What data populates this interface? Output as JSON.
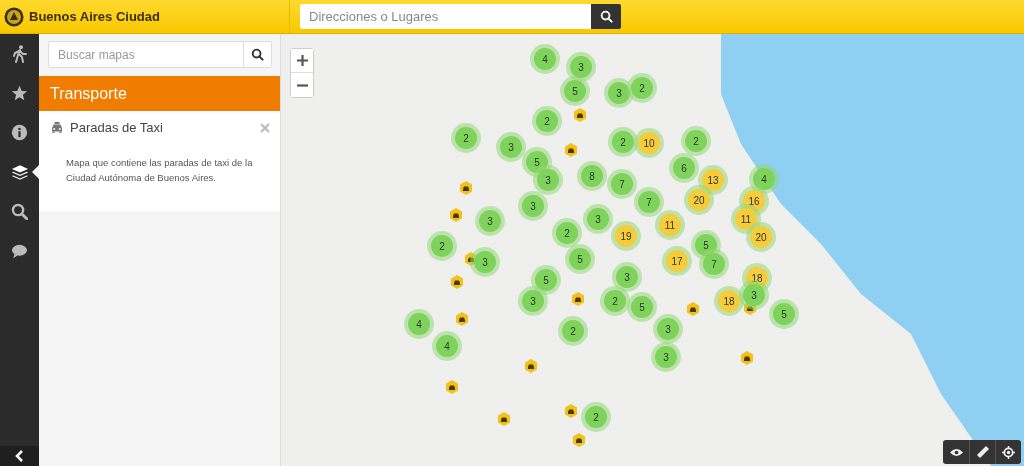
{
  "header": {
    "brand": "Buenos Aires Ciudad",
    "search": {
      "placeholder": "Direcciones o Lugares"
    }
  },
  "rail": [
    {
      "kind": "walk",
      "selected": false
    },
    {
      "kind": "star",
      "selected": false
    },
    {
      "kind": "info",
      "selected": false
    },
    {
      "kind": "layers",
      "selected": true
    },
    {
      "kind": "search",
      "selected": false
    },
    {
      "kind": "chat",
      "selected": false
    }
  ],
  "panel": {
    "search": {
      "placeholder": "Buscar mapas"
    },
    "title": "Transporte",
    "layers": [
      {
        "name": "Paradas de Taxi",
        "description": "Mapa que contiene las paradas de taxi de la Ciudad Autónoma de Buenos Aires."
      }
    ]
  },
  "map": {
    "clusters": [
      {
        "count": "4",
        "color": "#7ed35a"
      },
      {
        "count": "5",
        "color": "#7ed35a"
      },
      {
        "count": "3",
        "color": "#7ed35a"
      },
      {
        "count": "3",
        "color": "#7ed35a"
      },
      {
        "count": "2",
        "color": "#7ed35a"
      },
      {
        "count": "2",
        "color": "#7ed35a"
      },
      {
        "count": "3",
        "color": "#7ed35a"
      },
      {
        "count": "2",
        "color": "#7ed35a"
      },
      {
        "count": "2",
        "color": "#7ed35a"
      },
      {
        "count": "10",
        "color": "#f4cc3c"
      },
      {
        "count": "2",
        "color": "#7ed35a"
      },
      {
        "count": "5",
        "color": "#7ed35a"
      },
      {
        "count": "3",
        "color": "#7ed35a"
      },
      {
        "count": "8",
        "color": "#7ed35a"
      },
      {
        "count": "7",
        "color": "#7ed35a"
      },
      {
        "count": "6",
        "color": "#7ed35a"
      },
      {
        "count": "13",
        "color": "#f4cc3c"
      },
      {
        "count": "4",
        "color": "#7ed35a"
      },
      {
        "count": "3",
        "color": "#7ed35a"
      },
      {
        "count": "7",
        "color": "#7ed35a"
      },
      {
        "count": "20",
        "color": "#f4cc3c"
      },
      {
        "count": "16",
        "color": "#f4cc3c"
      },
      {
        "count": "3",
        "color": "#7ed35a"
      },
      {
        "count": "3",
        "color": "#7ed35a"
      },
      {
        "count": "11",
        "color": "#f4cc3c"
      },
      {
        "count": "11",
        "color": "#f4cc3c"
      },
      {
        "count": "2",
        "color": "#7ed35a"
      },
      {
        "count": "2",
        "color": "#7ed35a"
      },
      {
        "count": "19",
        "color": "#f4cc3c"
      },
      {
        "count": "5",
        "color": "#7ed35a"
      },
      {
        "count": "20",
        "color": "#f4cc3c"
      },
      {
        "count": "3",
        "color": "#7ed35a"
      },
      {
        "count": "5",
        "color": "#7ed35a"
      },
      {
        "count": "17",
        "color": "#f4cc3c"
      },
      {
        "count": "7",
        "color": "#7ed35a"
      },
      {
        "count": "5",
        "color": "#7ed35a"
      },
      {
        "count": "3",
        "color": "#7ed35a"
      },
      {
        "count": "18",
        "color": "#f4cc3c"
      },
      {
        "count": "3",
        "color": "#7ed35a"
      },
      {
        "count": "2",
        "color": "#7ed35a"
      },
      {
        "count": "5",
        "color": "#7ed35a"
      },
      {
        "count": "18",
        "color": "#f4cc3c"
      },
      {
        "count": "3",
        "color": "#7ed35a"
      },
      {
        "count": "5",
        "color": "#7ed35a"
      },
      {
        "count": "4",
        "color": "#7ed35a"
      },
      {
        "count": "2",
        "color": "#7ed35a"
      },
      {
        "count": "3",
        "color": "#7ed35a"
      },
      {
        "count": "4",
        "color": "#7ed35a"
      },
      {
        "count": "3",
        "color": "#7ed35a"
      },
      {
        "count": "2",
        "color": "#7ed35a"
      }
    ]
  }
}
